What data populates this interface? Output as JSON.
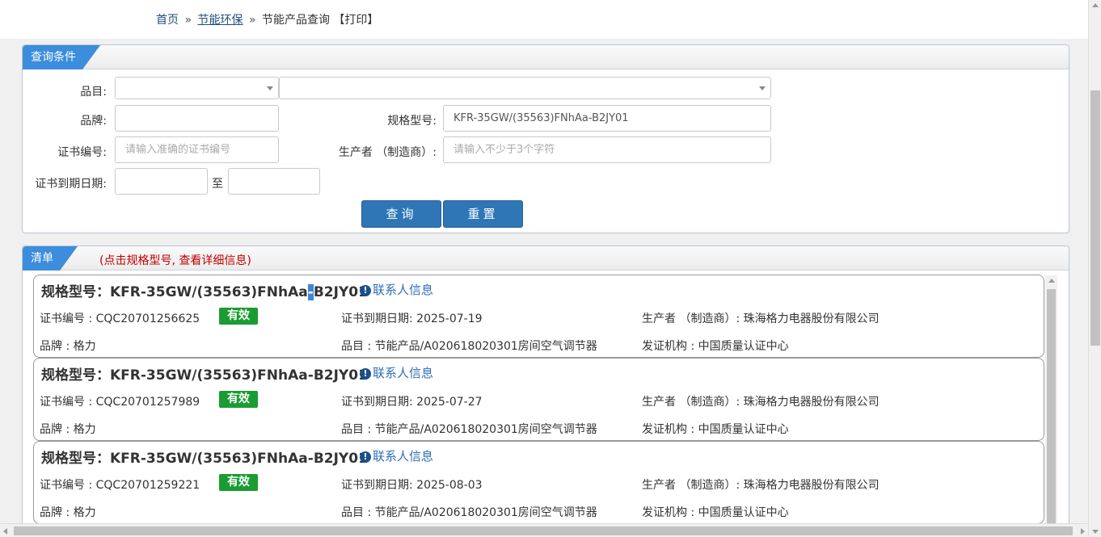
{
  "breadcrumb": {
    "home": "首页",
    "sep": "»",
    "category": "节能环保",
    "current": "节能产品查询",
    "print": "【打印】"
  },
  "query": {
    "tab_label": "查询条件",
    "category_label": "品目:",
    "category_value": "",
    "subcategory_value": "",
    "brand_label": "品牌:",
    "brand_value": "",
    "model_label": "规格型号:",
    "model_value": "KFR-35GW/(35563)FNhAa-B2JY01",
    "cert_label": "证书编号:",
    "cert_placeholder": "请输入准确的证书编号",
    "maker_label": "生产者 （制造商）:",
    "maker_placeholder": "请输入不少于3个字符",
    "expiry_label": "证书到期日期:",
    "expiry_to": "至",
    "expiry_from_value": "",
    "expiry_to_value": "",
    "search_button": "查询",
    "reset_button": "重置"
  },
  "list": {
    "tab_label": "清单",
    "hint": "(点击规格型号, 查看详细信息)",
    "title_prefix": "规格型号：",
    "contact_label": "联系人信息",
    "cert_label": "证书编号 : ",
    "expiry_label": "证书到期日期: ",
    "maker_label": "生产者 （制造商）: ",
    "brand_label": "品牌 : ",
    "category_label": "品目 : ",
    "issuer_label": "发证机构 : ",
    "items": [
      {
        "model_a": "KFR-35GW/(35563)FNhAa",
        "model_sel": "-",
        "model_b": "B2JY01",
        "cert_no": "CQC20701256625",
        "status": "有效",
        "expiry": "2025-07-19",
        "maker": "珠海格力电器股份有限公司",
        "brand": "格力",
        "category": "节能产品/A020618020301房间空气调节器",
        "issuer": "中国质量认证中心"
      },
      {
        "model_a": "KFR-35GW/(35563)FNhAa-B2JY01",
        "model_sel": "",
        "model_b": "",
        "cert_no": "CQC20701257989",
        "status": "有效",
        "expiry": "2025-07-27",
        "maker": "珠海格力电器股份有限公司",
        "brand": "格力",
        "category": "节能产品/A020618020301房间空气调节器",
        "issuer": "中国质量认证中心"
      },
      {
        "model_a": "KFR-35GW/(35563)FNhAa-B2JY01",
        "model_sel": "",
        "model_b": "",
        "cert_no": "CQC20701259221",
        "status": "有效",
        "expiry": "2025-08-03",
        "maker": "珠海格力电器股份有限公司",
        "brand": "格力",
        "category": "节能产品/A020618020301房间空气调节器",
        "issuer": "中国质量认证中心"
      }
    ]
  },
  "colors": {
    "accent": "#3c8ddc",
    "button": "#2f76b7",
    "valid_badge": "#1a9c32",
    "hint_red": "#c00000",
    "link": "#2f6db5"
  },
  "icons": {
    "info": "info-circle-icon",
    "dropdown": "chevron-down-icon"
  }
}
